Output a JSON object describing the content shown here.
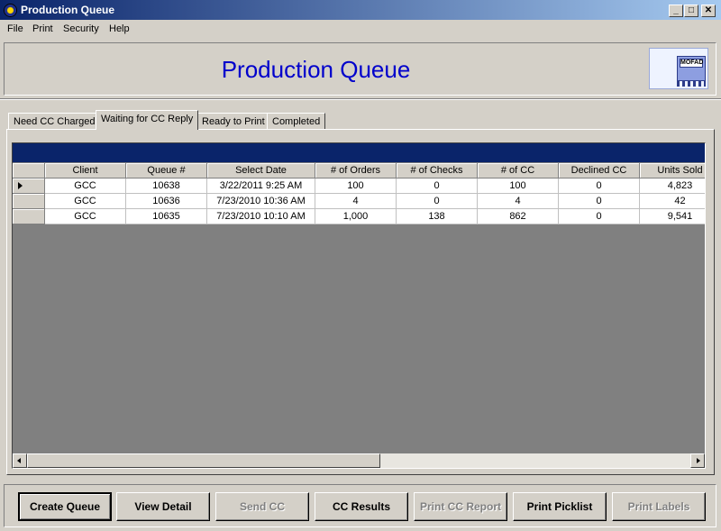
{
  "window": {
    "title": "Production Queue",
    "min_glyph": "_",
    "max_glyph": "□",
    "close_glyph": "✕"
  },
  "menu": [
    "File",
    "Print",
    "Security",
    "Help"
  ],
  "header": {
    "title": "Production Queue",
    "logo_text": "MOFAD"
  },
  "tabs": [
    {
      "label": "Need CC Charged",
      "active": false
    },
    {
      "label": "Waiting for CC Reply",
      "active": true
    },
    {
      "label": "Ready to Print",
      "active": false
    },
    {
      "label": "Completed",
      "active": false
    }
  ],
  "grid": {
    "columns": [
      "Client",
      "Queue #",
      "Select Date",
      "# of Orders",
      "# of Checks",
      "# of CC",
      "Declined CC",
      "Units Sold"
    ],
    "rows": [
      [
        "GCC",
        "10638",
        "3/22/2011 9:25 AM",
        "100",
        "0",
        "100",
        "0",
        "4,823"
      ],
      [
        "GCC",
        "10636",
        "7/23/2010 10:36 AM",
        "4",
        "0",
        "4",
        "0",
        "42"
      ],
      [
        "GCC",
        "10635",
        "7/23/2010 10:10 AM",
        "1,000",
        "138",
        "862",
        "0",
        "9,541"
      ]
    ],
    "selected_row": 0
  },
  "buttons": [
    {
      "label": "Create Queue",
      "enabled": true,
      "default": true
    },
    {
      "label": "View Detail",
      "enabled": true,
      "default": false
    },
    {
      "label": "Send CC",
      "enabled": false,
      "default": false
    },
    {
      "label": "CC Results",
      "enabled": true,
      "default": false
    },
    {
      "label": "Print CC Report",
      "enabled": false,
      "default": false
    },
    {
      "label": "Print Picklist",
      "enabled": true,
      "default": false
    },
    {
      "label": "Print Labels",
      "enabled": false,
      "default": false
    }
  ],
  "colors": {
    "header_title": "#0000cc",
    "titlebar_start": "#0a246a",
    "titlebar_end": "#a6caf0",
    "grid_caption": "#0a246a"
  }
}
